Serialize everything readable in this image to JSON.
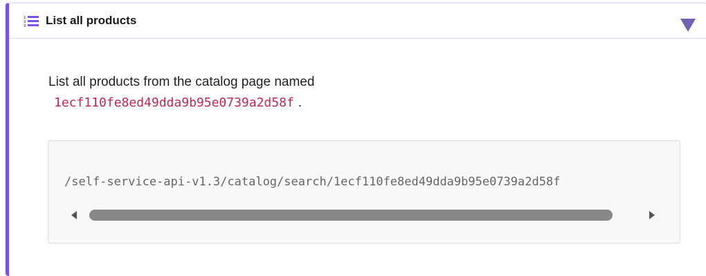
{
  "card": {
    "title": "List all products",
    "accent_color": "#7b52e6",
    "list_icon": "numbered-list-icon",
    "toggle_icon": "triangle-down-icon"
  },
  "content": {
    "description_prefix": "List all products from the catalog page named",
    "catalog_id": "1ecf110fe8ed49dda9b95e0739a2d58f",
    "description_suffix": ".",
    "code_sample": "/self-service-api-v1.3/catalog/search/1ecf110fe8ed49dda9b95e0739a2d58f"
  },
  "scrollbar": {
    "left_arrow_icon": "scroll-left-arrow-icon",
    "right_arrow_icon": "scroll-right-arrow-icon"
  }
}
